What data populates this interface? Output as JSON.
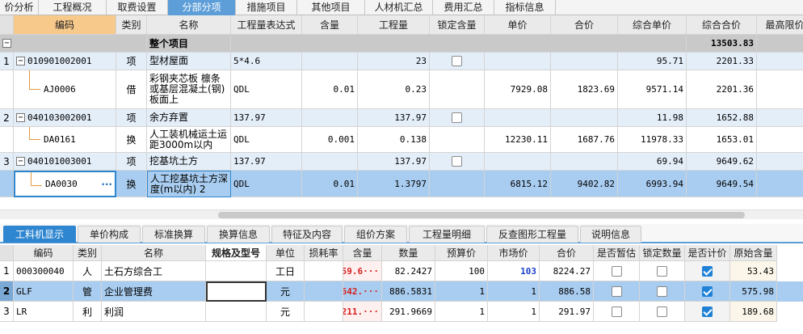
{
  "top_tabs": [
    "价分析",
    "工程概况",
    "取费设置",
    "分部分项",
    "措施项目",
    "其他项目",
    "人材机汇总",
    "费用汇总",
    "指标信息"
  ],
  "active_tab": "分部分项",
  "grid": {
    "headers": [
      "",
      "编码",
      "类别",
      "名称",
      "工程量表达式",
      "含量",
      "工程量",
      "锁定含量",
      "单价",
      "合价",
      "综合单价",
      "综合合价",
      "最高限价"
    ],
    "summary": {
      "toggle": "−",
      "name": "整个项目",
      "total": "13503.83"
    },
    "rows": [
      {
        "no": "1",
        "toggle": "−",
        "code": "010901002001",
        "type": "项",
        "name": "型材屋面",
        "expr": "5*4.6",
        "content": "",
        "qty": "23",
        "unit_price": "",
        "sum": "",
        "comp_unit": "95.71",
        "comp_total": "2201.33",
        "kind": "item"
      },
      {
        "no": "",
        "toggle": "",
        "code": "AJ0006",
        "type": "借",
        "name": "彩钢夹芯板 檩条或基层混凝土(钢)板面上",
        "expr": "QDL",
        "content": "0.01",
        "qty": "0.23",
        "unit_price": "7929.08",
        "sum": "1823.69",
        "comp_unit": "9571.14",
        "comp_total": "2201.36",
        "kind": "sub"
      },
      {
        "no": "2",
        "toggle": "−",
        "code": "040103002001",
        "type": "项",
        "name": "余方弃置",
        "expr": "137.97",
        "content": "",
        "qty": "137.97",
        "unit_price": "",
        "sum": "",
        "comp_unit": "11.98",
        "comp_total": "1652.88",
        "kind": "item"
      },
      {
        "no": "",
        "toggle": "",
        "code": "DA0161",
        "type": "换",
        "name": "人工装机械运土运距3000m以内",
        "expr": "QDL",
        "content": "0.001",
        "qty": "0.138",
        "unit_price": "12230.11",
        "sum": "1687.76",
        "comp_unit": "11978.33",
        "comp_total": "1653.01",
        "kind": "sub"
      },
      {
        "no": "3",
        "toggle": "−",
        "code": "040101003001",
        "type": "项",
        "name": "挖基坑土方",
        "expr": "137.97",
        "content": "",
        "qty": "137.97",
        "unit_price": "",
        "sum": "",
        "comp_unit": "69.94",
        "comp_total": "9649.62",
        "kind": "item"
      },
      {
        "no": "",
        "toggle": "",
        "code": "DA0030",
        "type": "换",
        "name": "人工挖基坑土方深度(m以内) 2",
        "expr": "QDL",
        "content": "0.01",
        "qty": "1.3797",
        "unit_price": "6815.12",
        "sum": "9402.82",
        "comp_unit": "6993.94",
        "comp_total": "9649.54",
        "kind": "selected",
        "more": "···"
      }
    ]
  },
  "sub_tabs": [
    "工料机显示",
    "单价构成",
    "标准换算",
    "换算信息",
    "特征及内容",
    "组价方案",
    "工程量明细",
    "反查图形工程量",
    "说明信息"
  ],
  "active_sub_tab": "工料机显示",
  "lower": {
    "headers": [
      "",
      "编码",
      "类别",
      "名称",
      "规格及型号",
      "单位",
      "损耗率",
      "含量",
      "数量",
      "预算价",
      "市场价",
      "合价",
      "是否暂估",
      "锁定数量",
      "是否计价",
      "原始含量"
    ],
    "rows": [
      {
        "no": "1",
        "code": "000300040",
        "type": "人",
        "name": "土石方综合工",
        "spec": "",
        "unit": "工日",
        "loss": "",
        "content": "59.6···",
        "qty": "82.2427",
        "budget": "100",
        "market": "103",
        "sum": "8224.27",
        "est": false,
        "lock": false,
        "priced": true,
        "orig": "53.43"
      },
      {
        "no": "2",
        "code": "GLF",
        "type": "管",
        "name": "企业管理费",
        "spec": "",
        "unit": "元",
        "loss": "",
        "content": "642.···",
        "qty": "886.5831",
        "budget": "1",
        "market": "1",
        "sum": "886.58",
        "est": false,
        "lock": false,
        "priced": true,
        "orig": "575.98"
      },
      {
        "no": "3",
        "code": "LR",
        "type": "利",
        "name": "利润",
        "spec": "",
        "unit": "元",
        "loss": "",
        "content": "211.···",
        "qty": "291.9669",
        "budget": "1",
        "market": "1",
        "sum": "291.97",
        "est": false,
        "lock": false,
        "priced": true,
        "orig": "189.68"
      }
    ]
  }
}
